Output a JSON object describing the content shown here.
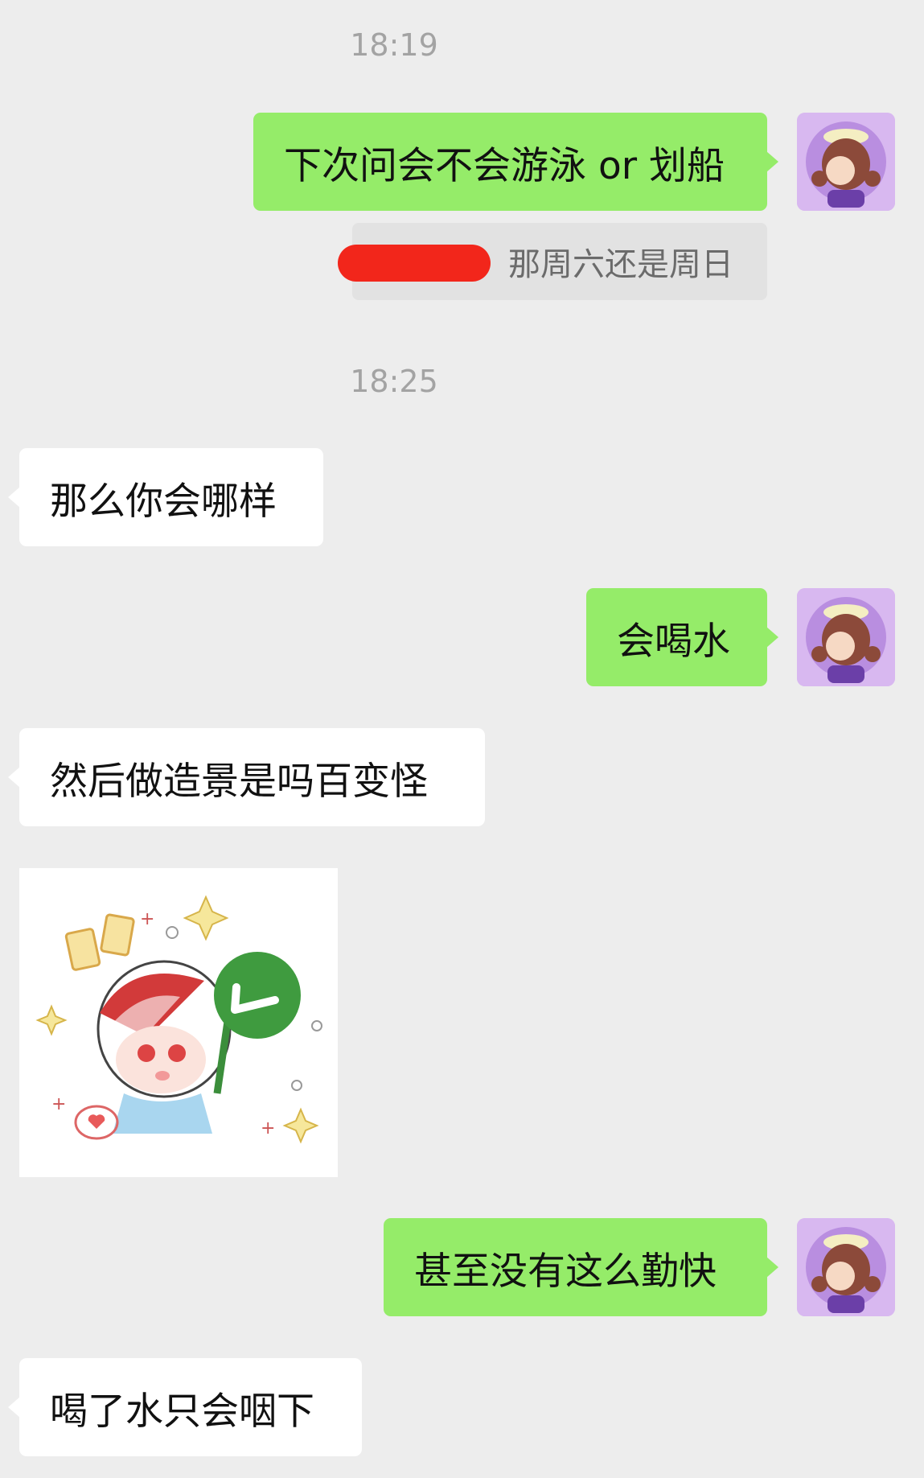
{
  "chat": {
    "timestamps": [
      "18:19",
      "18:25"
    ],
    "messages": [
      {
        "side": "me",
        "text": "下次问会不会游泳 or 划船"
      },
      {
        "side": "me",
        "quote": "那周六还是周日"
      },
      {
        "side": "other",
        "text": "那么你会哪样"
      },
      {
        "side": "me",
        "text": "会喝水"
      },
      {
        "side": "other",
        "text": "然后做造景是吗百变怪"
      },
      {
        "side": "other",
        "sticker": "cartoon-girl-checkmark-sign-sticker"
      },
      {
        "side": "me",
        "text": "甚至没有这么勤快"
      },
      {
        "side": "other",
        "text": "喝了水只会咽下"
      }
    ]
  },
  "colors": {
    "background": "#ededed",
    "my_bubble": "#95ec69",
    "other_bubble": "#ffffff",
    "quote_bg": "#e2e2e2",
    "timestamp": "#a3a3a3",
    "redaction": "#f2261b"
  },
  "icons": {
    "my_avatar": "cartoon-girl-avatar-icon",
    "check_sign": "checkmark-icon"
  }
}
